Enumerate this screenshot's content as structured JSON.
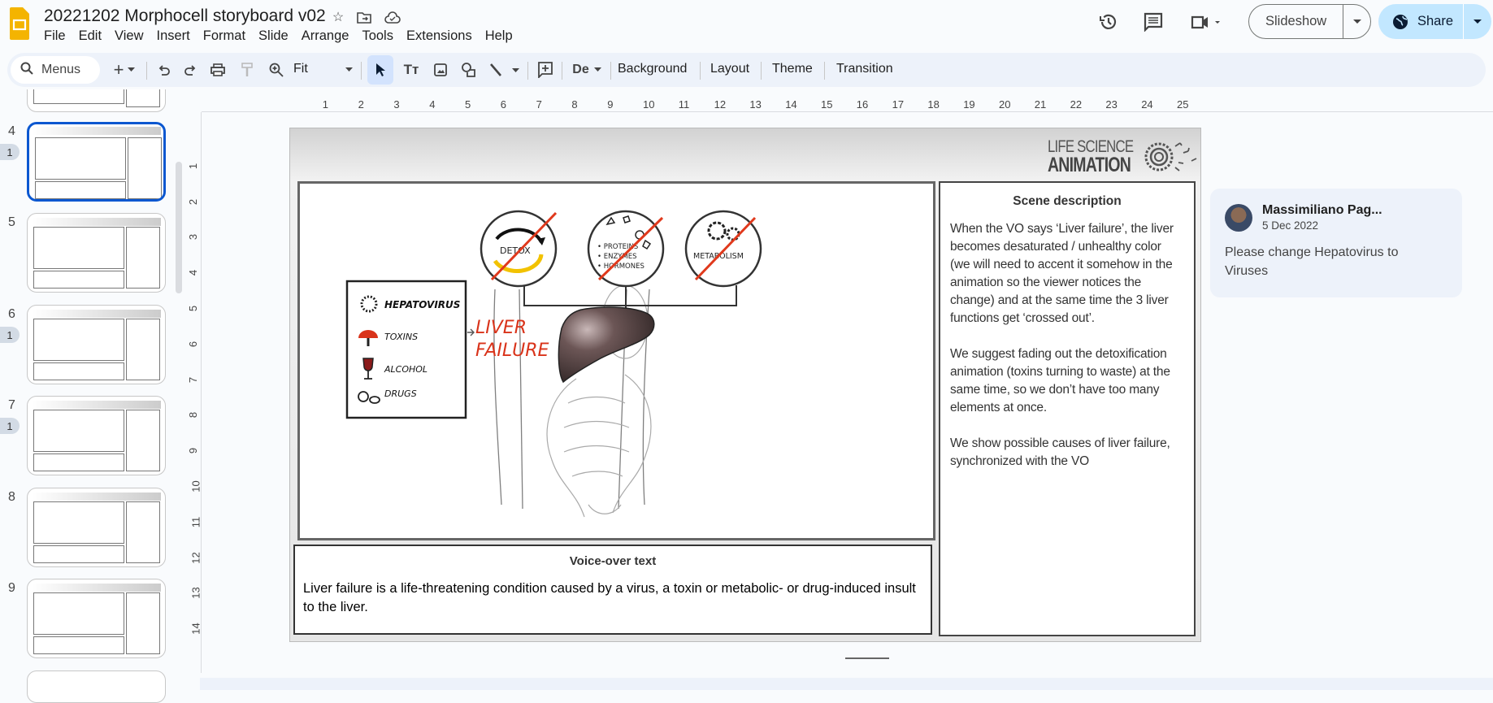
{
  "app": {
    "title": "20221202 Morphocell storyboard v02",
    "menu": [
      "File",
      "Edit",
      "View",
      "Insert",
      "Format",
      "Slide",
      "Arrange",
      "Tools",
      "Extensions",
      "Help"
    ],
    "slideshow_label": "Slideshow",
    "share_label": "Share",
    "accent": "#0b57d0"
  },
  "toolbar": {
    "menus_label": "Menus",
    "zoom_value": "Fit",
    "background_label": "Background",
    "layout_label": "Layout",
    "theme_label": "Theme",
    "transition_label": "Transition"
  },
  "filmstrip": {
    "slides": [
      {
        "number": "4",
        "comments": "1",
        "selected": true
      },
      {
        "number": "5",
        "comments": ""
      },
      {
        "number": "6",
        "comments": "1"
      },
      {
        "number": "7",
        "comments": "1"
      },
      {
        "number": "8",
        "comments": ""
      },
      {
        "number": "9",
        "comments": ""
      }
    ]
  },
  "rulers": {
    "horizontal": [
      "1",
      "2",
      "3",
      "4",
      "5",
      "6",
      "7",
      "8",
      "9",
      "10",
      "11",
      "12",
      "13",
      "14",
      "15",
      "16",
      "17",
      "18",
      "19",
      "20",
      "21",
      "22",
      "23",
      "24",
      "25"
    ],
    "vertical": [
      "1",
      "2",
      "3",
      "4",
      "5",
      "6",
      "7",
      "8",
      "9",
      "10",
      "11",
      "12",
      "13",
      "14"
    ]
  },
  "slide": {
    "brand_line1": "LIFE SCIENCE",
    "brand_line2": "ANIMATION",
    "drawing": {
      "functions": [
        "DETOX",
        "• PROTEINS",
        "• ENZYMES",
        "• HORMONES",
        "METABOLISM"
      ],
      "causes": [
        "HEPATOVIRUS",
        "TOXINS",
        "ALCOHOL",
        "DRUGS"
      ],
      "liver_label_1": "LIVER",
      "liver_label_2": "FAILURE"
    },
    "scene_title": "Scene description",
    "scene_paragraphs": [
      "When the VO says ‘Liver failure’, the liver becomes desaturated / unhealthy color (we will need to accent it somehow in the animation so the viewer notices the change)  and at the same time the 3 liver functions get ‘crossed out’.",
      "We suggest fading out the detoxification animation (toxins turning to waste) at the same time, so we don’t have too many elements at once.",
      "We show possible causes of liver failure, synchronized with the VO"
    ],
    "vo_title": "Voice-over text",
    "vo_text": "Liver failure is a life-threatening condition caused by a virus, a toxin or metabolic- or drug-induced insult to the liver."
  },
  "comment": {
    "author": "Massimiliano Pag...",
    "date": "5 Dec 2022",
    "text": "Please change Hepatovirus to Viruses"
  }
}
